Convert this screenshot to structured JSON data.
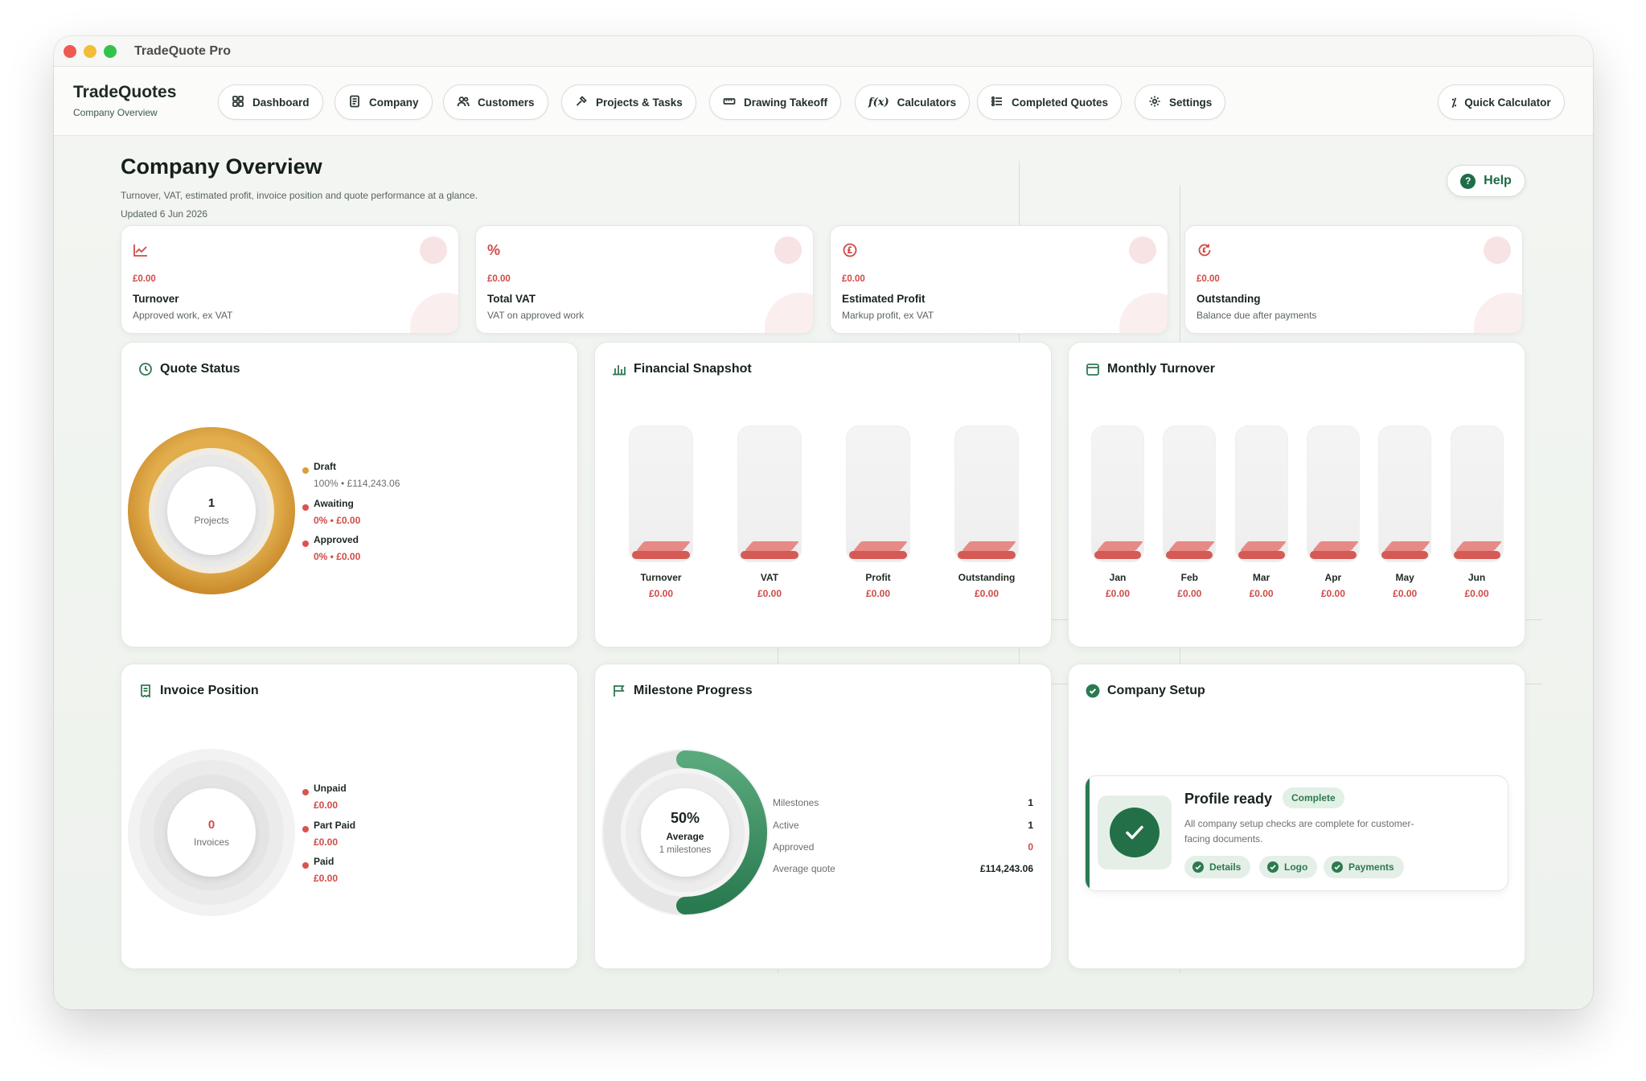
{
  "window": {
    "title": "TradeQuote Pro"
  },
  "brand": {
    "name": "TradeQuotes",
    "subtitle": "Company Overview"
  },
  "nav": {
    "items": [
      {
        "label": "Dashboard",
        "icon": "grid-icon"
      },
      {
        "label": "Company",
        "icon": "document-icon"
      },
      {
        "label": "Customers",
        "icon": "users-icon"
      },
      {
        "label": "Projects & Tasks",
        "icon": "hammer-icon"
      },
      {
        "label": "Drawing Takeoff",
        "icon": "ruler-icon"
      },
      {
        "label": "Calculators",
        "icon": "function-icon"
      },
      {
        "label": "Completed Quotes",
        "icon": "checklist-icon"
      },
      {
        "label": "Settings",
        "icon": "gear-icon"
      }
    ],
    "quick_calculator": "Quick Calculator"
  },
  "page": {
    "title": "Company Overview",
    "subtitle": "Turnover, VAT, estimated profit, invoice position and quote performance at a glance.",
    "updated": "Updated 6 Jun 2026",
    "help": "Help"
  },
  "kpis": [
    {
      "value": "£0.00",
      "label": "Turnover",
      "desc": "Approved work, ex VAT",
      "icon": "trend-chart-icon"
    },
    {
      "value": "£0.00",
      "label": "Total VAT",
      "desc": "VAT on approved work",
      "icon": "percent-icon"
    },
    {
      "value": "£0.00",
      "label": "Estimated Profit",
      "desc": "Markup profit, ex VAT",
      "icon": "pound-circle-icon"
    },
    {
      "value": "£0.00",
      "label": "Outstanding",
      "desc": "Balance due after payments",
      "icon": "refresh-pound-icon"
    }
  ],
  "quote_status": {
    "title": "Quote Status",
    "center_value": "1",
    "center_label": "Projects",
    "legend": [
      {
        "name": "Draft",
        "value": "100% • £114,243.06",
        "color": "#d8a035"
      },
      {
        "name": "Awaiting",
        "value": "0% • £0.00",
        "color": "#d9534f"
      },
      {
        "name": "Approved",
        "value": "0% • £0.00",
        "color": "#d9534f"
      }
    ]
  },
  "financial_snapshot": {
    "title": "Financial Snapshot",
    "bars": [
      {
        "label": "Turnover",
        "value": "£0.00"
      },
      {
        "label": "VAT",
        "value": "£0.00"
      },
      {
        "label": "Profit",
        "value": "£0.00"
      },
      {
        "label": "Outstanding",
        "value": "£0.00"
      }
    ]
  },
  "monthly_turnover": {
    "title": "Monthly Turnover",
    "bars": [
      {
        "label": "Jan",
        "value": "£0.00"
      },
      {
        "label": "Feb",
        "value": "£0.00"
      },
      {
        "label": "Mar",
        "value": "£0.00"
      },
      {
        "label": "Apr",
        "value": "£0.00"
      },
      {
        "label": "May",
        "value": "£0.00"
      },
      {
        "label": "Jun",
        "value": "£0.00"
      }
    ]
  },
  "invoice_position": {
    "title": "Invoice Position",
    "center_value": "0",
    "center_label": "Invoices",
    "legend": [
      {
        "name": "Unpaid",
        "value": "£0.00"
      },
      {
        "name": "Part Paid",
        "value": "£0.00"
      },
      {
        "name": "Paid",
        "value": "£0.00"
      }
    ]
  },
  "milestone_progress": {
    "title": "Milestone Progress",
    "percent": "50%",
    "progress_fraction": 0.5,
    "center_label": "Average",
    "center_sub": "1 milestones",
    "stats": [
      {
        "label": "Milestones",
        "value": "1"
      },
      {
        "label": "Active",
        "value": "1"
      },
      {
        "label": "Approved",
        "value": "0"
      },
      {
        "label": "Average quote",
        "value": "£114,243.06"
      }
    ]
  },
  "company_setup": {
    "title": "Company Setup",
    "status_title": "Profile ready",
    "badge": "Complete",
    "desc": "All company setup checks are complete for customer-facing documents.",
    "chips": [
      "Details",
      "Logo",
      "Payments"
    ]
  },
  "colors": {
    "accent": "#2a7a51",
    "danger": "#cf4b47",
    "gold": "#d19a2f"
  }
}
